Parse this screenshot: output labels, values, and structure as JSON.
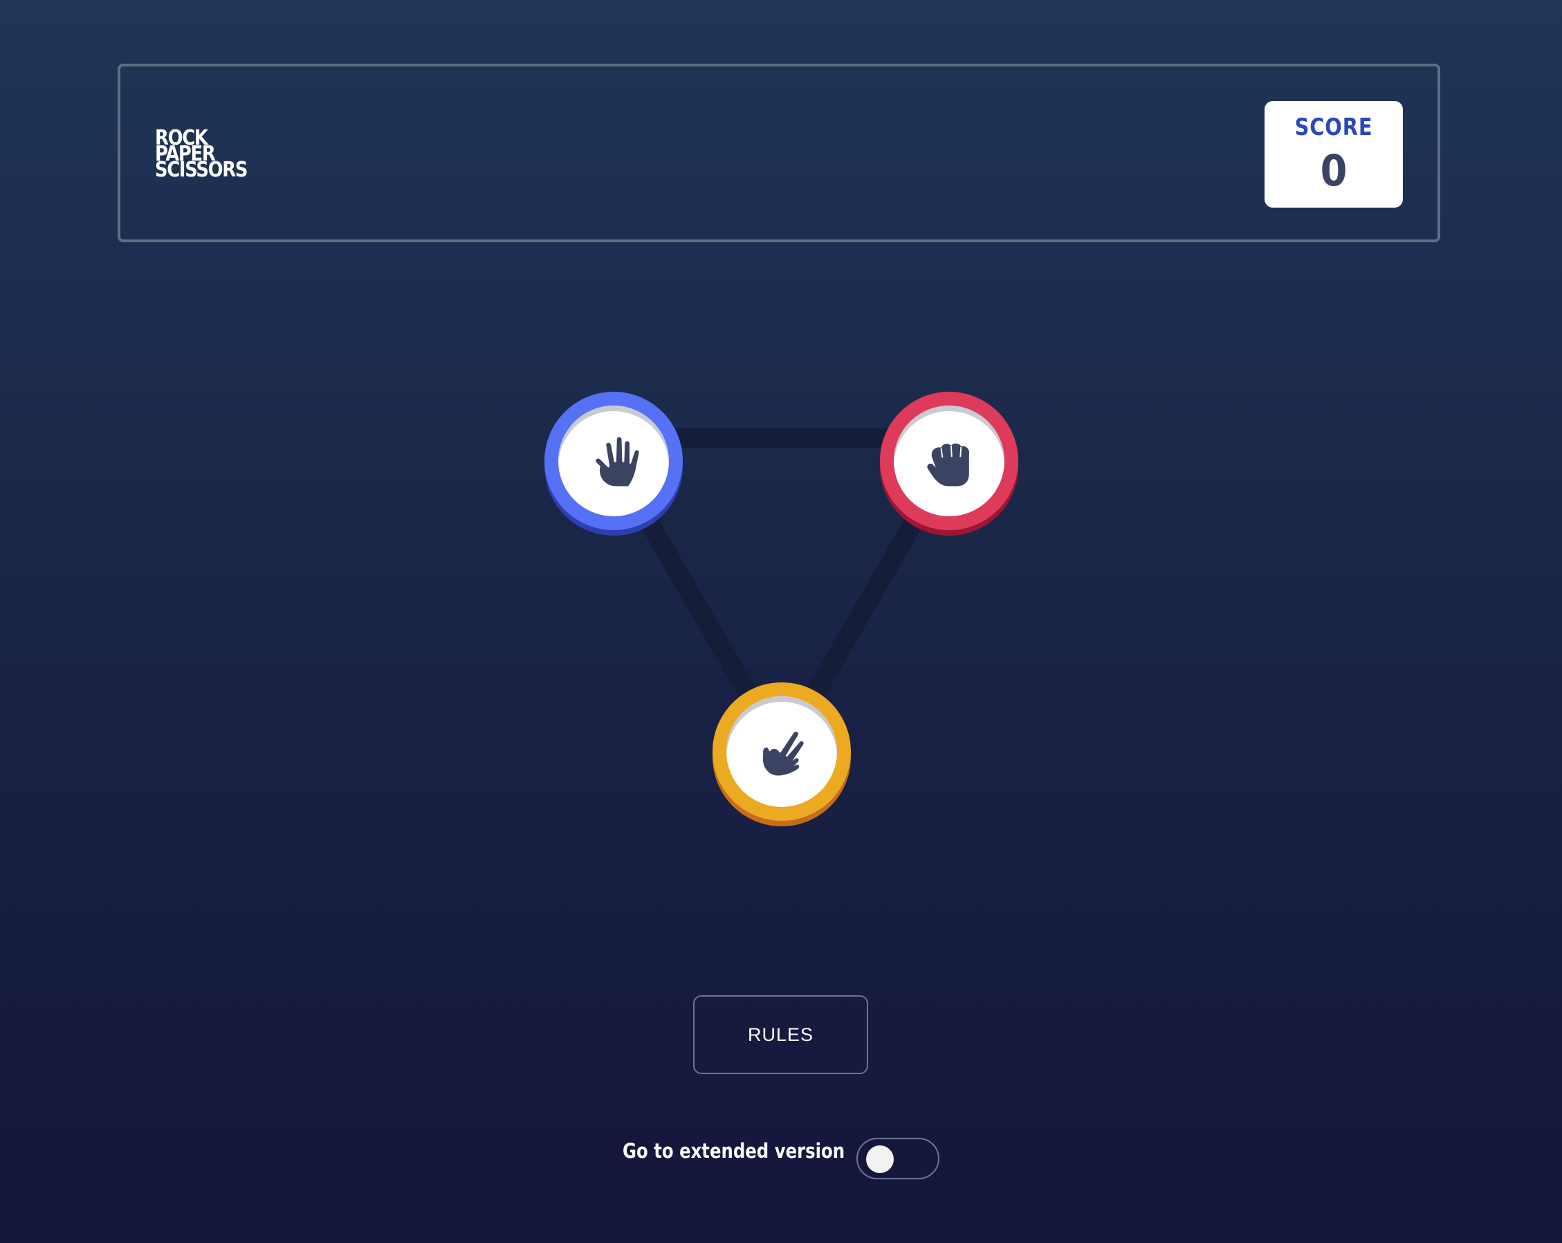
{
  "header": {
    "logo_lines": [
      "ROCK",
      "PAPER",
      "SCISSORS"
    ],
    "score_label": "SCORE",
    "score_value": "0"
  },
  "choices": [
    {
      "name": "paper",
      "icon": "paper-hand-icon",
      "color": "#5671f5"
    },
    {
      "name": "rock",
      "icon": "rock-fist-icon",
      "color": "#de3a5a"
    },
    {
      "name": "scissors",
      "icon": "scissors-hand-icon",
      "color": "#eca922"
    }
  ],
  "rules_button": {
    "label": "RULES"
  },
  "extended_toggle": {
    "label": "Go to extended version",
    "on": false
  }
}
